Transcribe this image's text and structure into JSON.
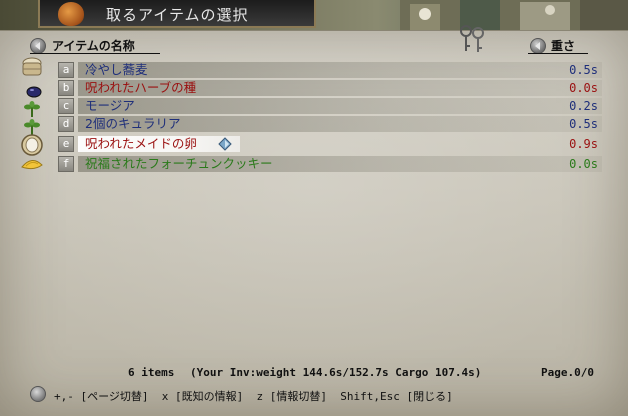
{
  "window": {
    "title": "取るアイテムの選択"
  },
  "header": {
    "name_label": "アイテムの名称",
    "weight_label": "重さ"
  },
  "items": [
    {
      "letter": "a",
      "name": "冷やし蕎麦",
      "weight": "0.5s",
      "name_color": "#1f2f7a",
      "weight_color": "#1f2f7a",
      "icon": "basket-icon"
    },
    {
      "letter": "b",
      "name": "呪われたハーブの種",
      "weight": "0.0s",
      "name_color": "#9a1010",
      "weight_color": "#9a1010",
      "icon": "seed-icon"
    },
    {
      "letter": "c",
      "name": "モージア",
      "weight": "0.2s",
      "name_color": "#1f2f7a",
      "weight_color": "#1f2f7a",
      "icon": "herb-icon"
    },
    {
      "letter": "d",
      "name": "2個のキュラリア",
      "weight": "0.5s",
      "name_color": "#1f2f7a",
      "weight_color": "#1f2f7a",
      "icon": "herb-icon"
    },
    {
      "letter": "e",
      "name": "呪われたメイドの卵",
      "weight": "0.9s",
      "name_color": "#9a1010",
      "weight_color": "#9a1010",
      "icon": "egg-icon",
      "selected": true
    },
    {
      "letter": "f",
      "name": "祝福されたフォーチュンクッキー",
      "weight": "0.0s",
      "name_color": "#2a7a1a",
      "weight_color": "#2a7a1a",
      "icon": "cookie-icon"
    }
  ],
  "status": {
    "count": "6 items",
    "inventory": "(Your Inv:weight 144.6s/152.7s Cargo 107.4s)",
    "page": "Page.0/0"
  },
  "help": {
    "text": "+,- [ページ切替]  x [既知の情報]  z [情報切替]  Shift,Esc [閉じる]"
  }
}
